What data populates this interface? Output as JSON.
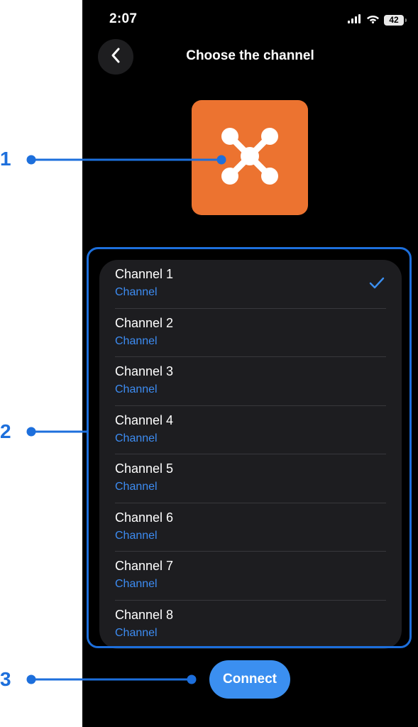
{
  "status_bar": {
    "time": "2:07",
    "battery": "42",
    "icons": [
      "cellular-signal-icon",
      "wifi-icon",
      "battery-icon"
    ]
  },
  "nav": {
    "back_icon": "chevron-left-icon",
    "title": "Choose the channel"
  },
  "app_icon": {
    "name": "network-node-icon",
    "background": "#ec7330"
  },
  "channel_list": {
    "selected_index": 0,
    "items": [
      {
        "title": "Channel 1",
        "subtitle": "Channel",
        "selected": true
      },
      {
        "title": "Channel 2",
        "subtitle": "Channel",
        "selected": false
      },
      {
        "title": "Channel 3",
        "subtitle": "Channel",
        "selected": false
      },
      {
        "title": "Channel 4",
        "subtitle": "Channel",
        "selected": false
      },
      {
        "title": "Channel 5",
        "subtitle": "Channel",
        "selected": false
      },
      {
        "title": "Channel 6",
        "subtitle": "Channel",
        "selected": false
      },
      {
        "title": "Channel 7",
        "subtitle": "Channel",
        "selected": false
      },
      {
        "title": "Channel 8",
        "subtitle": "Channel",
        "selected": false
      }
    ]
  },
  "connect_button": {
    "label": "Connect"
  },
  "annotations": {
    "callouts": [
      "1",
      "2",
      "3"
    ],
    "color": "#1d6fdc"
  },
  "colors": {
    "background": "#000000",
    "accent": "#3b8ff0",
    "subtitle": "#3d8cf2",
    "card": "#1d1d20"
  }
}
